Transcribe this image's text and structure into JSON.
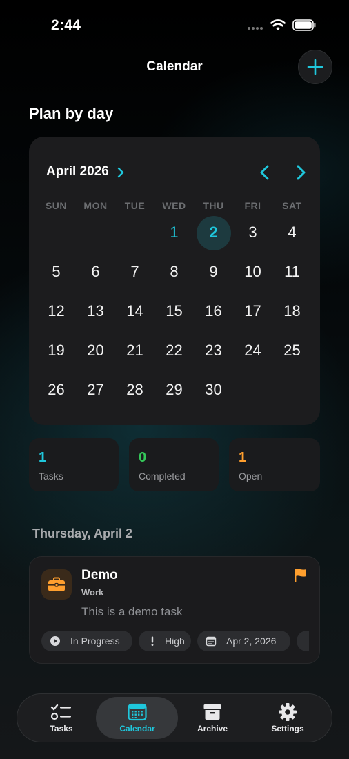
{
  "status_bar": {
    "time": "2:44"
  },
  "nav": {
    "title": "Calendar",
    "add_icon": "plus-icon"
  },
  "section_title": "Plan by day",
  "calendar": {
    "month_label": "April 2026",
    "weekdays": [
      "SUN",
      "MON",
      "TUE",
      "WED",
      "THU",
      "FRI",
      "SAT"
    ],
    "days": [
      "1",
      "2",
      "3",
      "4",
      "5",
      "6",
      "7",
      "8",
      "9",
      "10",
      "11",
      "12",
      "13",
      "14",
      "15",
      "16",
      "17",
      "18",
      "19",
      "20",
      "21",
      "22",
      "23",
      "24",
      "25",
      "26",
      "27",
      "28",
      "29",
      "30"
    ],
    "first_weekday_index": 3,
    "today": "1",
    "selected": "2",
    "accent_color": "#1fc7dc"
  },
  "stats": [
    {
      "value": "1",
      "label": "Tasks",
      "color": "#1fc7dc"
    },
    {
      "value": "0",
      "label": "Completed",
      "color": "#34c759"
    },
    {
      "value": "1",
      "label": "Open",
      "color": "#ff9f2e"
    }
  ],
  "date_heading": "Thursday, April 2",
  "task": {
    "icon": "briefcase-icon",
    "title": "Demo",
    "category": "Work",
    "description": "This is a demo task",
    "flag_color": "#ff9f2e",
    "chips": [
      {
        "icon": "play-circle-icon",
        "label": "In Progress"
      },
      {
        "icon": "exclamation-icon",
        "label": "High"
      },
      {
        "icon": "calendar-icon",
        "label": "Apr 2, 2026"
      }
    ]
  },
  "tabs": [
    {
      "label": "Tasks",
      "icon": "checklist-icon",
      "active": false
    },
    {
      "label": "Calendar",
      "icon": "calendar-icon",
      "active": true
    },
    {
      "label": "Archive",
      "icon": "archive-box-icon",
      "active": false
    },
    {
      "label": "Settings",
      "icon": "gear-icon",
      "active": false
    }
  ]
}
